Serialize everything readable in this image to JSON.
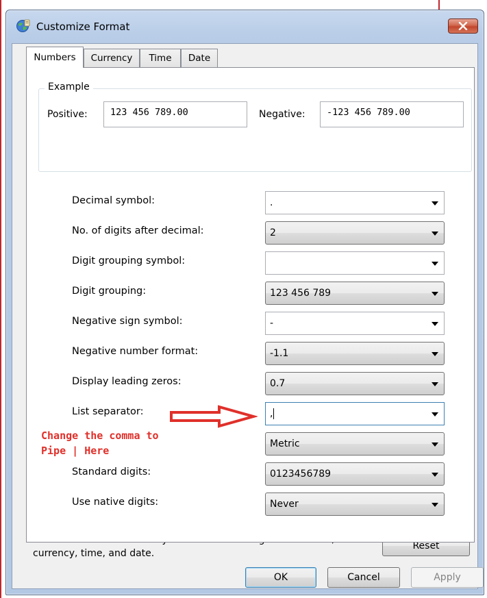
{
  "window": {
    "title": "Customize Format"
  },
  "tabs": [
    {
      "label": "Numbers",
      "active": true
    },
    {
      "label": "Currency",
      "active": false
    },
    {
      "label": "Time",
      "active": false
    },
    {
      "label": "Date",
      "active": false
    }
  ],
  "example": {
    "legend": "Example",
    "positive_label": "Positive:",
    "positive_value": "123 456 789.00",
    "negative_label": "Negative:",
    "negative_value": "-123 456 789.00"
  },
  "fields": [
    {
      "label": "Decimal symbol:",
      "value": "."
    },
    {
      "label": "No. of digits after decimal:",
      "value": "2"
    },
    {
      "label": "Digit grouping symbol:",
      "value": ""
    },
    {
      "label": "Digit grouping:",
      "value": "123 456 789"
    },
    {
      "label": "Negative sign symbol:",
      "value": "-"
    },
    {
      "label": "Negative number format:",
      "value": "-1.1"
    },
    {
      "label": "Display leading zeros:",
      "value": "0.7"
    },
    {
      "label": "List separator:",
      "value": ","
    },
    {
      "label": "",
      "value": "Metric"
    },
    {
      "label": "Standard digits:",
      "value": "0123456789"
    },
    {
      "label": "Use native digits:",
      "value": "Never"
    }
  ],
  "annotation": {
    "line1": "Change the comma to",
    "line2": "Pipe | Here",
    "color": "#e0302a"
  },
  "footer": {
    "reset_text": "Click Reset to restore the system default settings for numbers, currency, time, and date.",
    "reset_button": "Reset"
  },
  "buttons": {
    "ok": "OK",
    "cancel": "Cancel",
    "apply": "Apply"
  },
  "colors": {
    "title_bar": "#b9cde8",
    "close_button": "#c2462c",
    "panel": "#ffffff",
    "client": "#f0f0f0"
  }
}
